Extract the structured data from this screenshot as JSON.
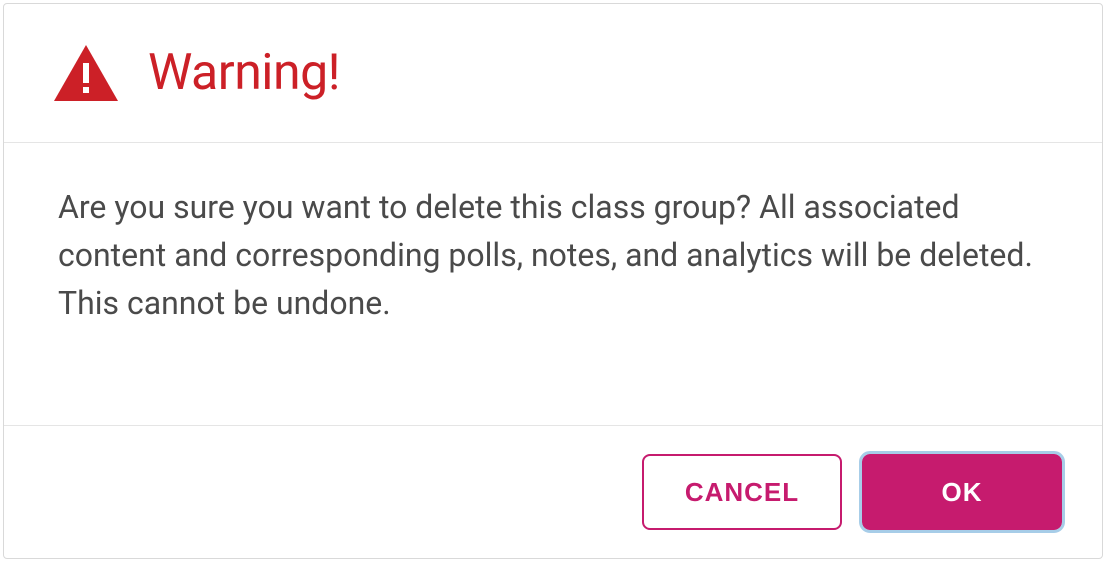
{
  "dialog": {
    "title": "Warning!",
    "message": "Are you sure you want to delete this class group? All associated content and corresponding polls, notes, and analytics will be deleted. This cannot be undone.",
    "cancel_label": "CANCEL",
    "ok_label": "OK"
  },
  "colors": {
    "warning_red": "#cc2027",
    "primary_pink": "#c61b6e",
    "focus_ring": "#a7cde8"
  }
}
